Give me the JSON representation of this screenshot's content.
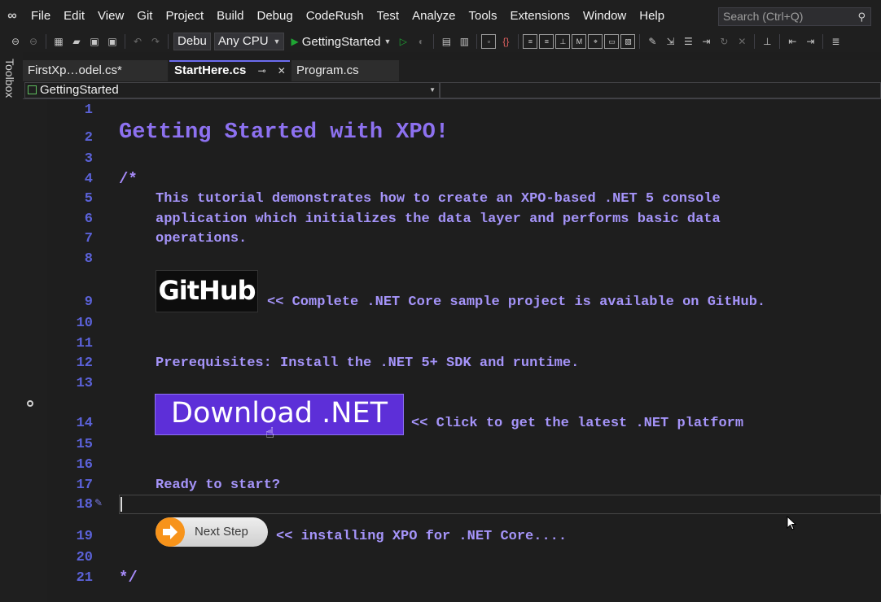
{
  "menu": {
    "items": [
      "File",
      "Edit",
      "View",
      "Git",
      "Project",
      "Build",
      "Debug",
      "CodeRush",
      "Test",
      "Analyze",
      "Tools",
      "Extensions",
      "Window",
      "Help"
    ],
    "search_placeholder": "Search (Ctrl+Q)"
  },
  "toolbar": {
    "configuration": "Debu",
    "platform": "Any CPU",
    "start_project": "GettingStarted"
  },
  "toolbox_label": "Toolbox",
  "tabs": [
    {
      "label": "FirstXp…odel.cs*",
      "active": false
    },
    {
      "label": "StartHere.cs",
      "active": true
    },
    {
      "label": "Program.cs",
      "active": false
    }
  ],
  "navigation": {
    "scope": "GettingStarted"
  },
  "editor": {
    "line_numbers": [
      "1",
      "2",
      "3",
      "4",
      "5",
      "6",
      "7",
      "8",
      "9",
      "10",
      "11",
      "12",
      "13",
      "14",
      "15",
      "16",
      "17",
      "18",
      "19",
      "20",
      "21"
    ],
    "title": "Getting Started with XPO!",
    "comment_open": "/*",
    "intro_line_1": "This tutorial demonstrates how to create an XPO-based .NET 5 console",
    "intro_line_2": "application which initializes the data layer and performs basic data",
    "intro_line_3": "operations.",
    "github_badge": "GitHub",
    "github_note": "<< Complete .NET Core sample project is available on GitHub.",
    "prerequisites": "Prerequisites: Install the .NET 5+ SDK and runtime.",
    "download_button": "Download .NET",
    "download_note": "<< Click to get the latest .NET platform",
    "ready": "Ready to start?",
    "next_button": "Next Step",
    "next_note": "<< installing XPO for .NET Core....",
    "comment_close": "*/"
  },
  "colors": {
    "accent_purple": "#5d2fd8",
    "code_text": "#a594f9",
    "line_number": "#5b62d8",
    "next_orange": "#f7931a"
  }
}
